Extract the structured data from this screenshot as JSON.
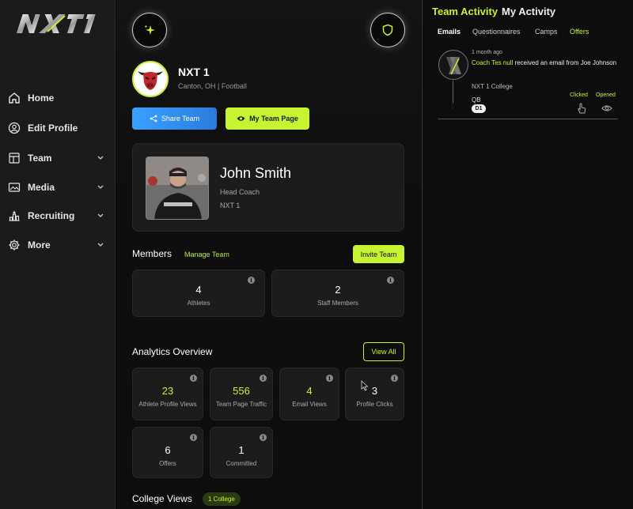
{
  "brand": {
    "logo_text": "NXT1",
    "accent": "#c6f432"
  },
  "sidebar": {
    "items": [
      {
        "label": "Home",
        "icon": "home-icon",
        "has_chevron": false
      },
      {
        "label": "Edit Profile",
        "icon": "user-circle-icon",
        "has_chevron": false
      },
      {
        "label": "Team",
        "icon": "layout-icon",
        "has_chevron": true
      },
      {
        "label": "Media",
        "icon": "image-folder-icon",
        "has_chevron": true
      },
      {
        "label": "Recruiting",
        "icon": "podium-icon",
        "has_chevron": true
      },
      {
        "label": "More",
        "icon": "gear-icon",
        "has_chevron": true
      }
    ]
  },
  "team": {
    "name": "NXT 1",
    "location": "Canton, OH | Football",
    "share_label": "Share Team",
    "team_page_label": "My Team Page"
  },
  "coach": {
    "name": "John Smith",
    "role": "Head Coach",
    "team": "NXT 1"
  },
  "members": {
    "title": "Members",
    "manage_label": "Manage Team",
    "invite_label": "Invite Team",
    "stats": [
      {
        "value": "4",
        "label": "Athletes"
      },
      {
        "value": "2",
        "label": "Staff Members"
      }
    ]
  },
  "analytics": {
    "title": "Analytics Overview",
    "view_all_label": "View All",
    "stats": [
      {
        "value": "23",
        "label": "Athlete Profile Views",
        "highlight": true
      },
      {
        "value": "556",
        "label": "Team Page Traffic",
        "highlight": true
      },
      {
        "value": "4",
        "label": "Email Views",
        "highlight": true
      },
      {
        "value": "3",
        "label": "Profile Clicks",
        "highlight": false
      },
      {
        "value": "6",
        "label": "Offers",
        "highlight": false
      },
      {
        "value": "1",
        "label": "Committed",
        "highlight": false
      }
    ]
  },
  "college_views": {
    "title": "College Views",
    "pill": "1 College"
  },
  "activity": {
    "tabs": [
      {
        "label": "Team Activity",
        "active": true
      },
      {
        "label": "My Activity",
        "active": false
      }
    ],
    "subtabs": [
      {
        "label": "Emails",
        "active": true
      },
      {
        "label": "Questionnaires",
        "active": false
      },
      {
        "label": "Camps",
        "active": false
      },
      {
        "label": "Offers",
        "active": false,
        "accent": true
      }
    ],
    "items": [
      {
        "time": "1 month ago",
        "actor": "Coach Tes null",
        "text": "received an email from Joe Johnson",
        "college": "NXT 1 College",
        "position": "QB",
        "division": "D1",
        "clicked_label": "Clicked",
        "opened_label": "Opened"
      }
    ]
  }
}
